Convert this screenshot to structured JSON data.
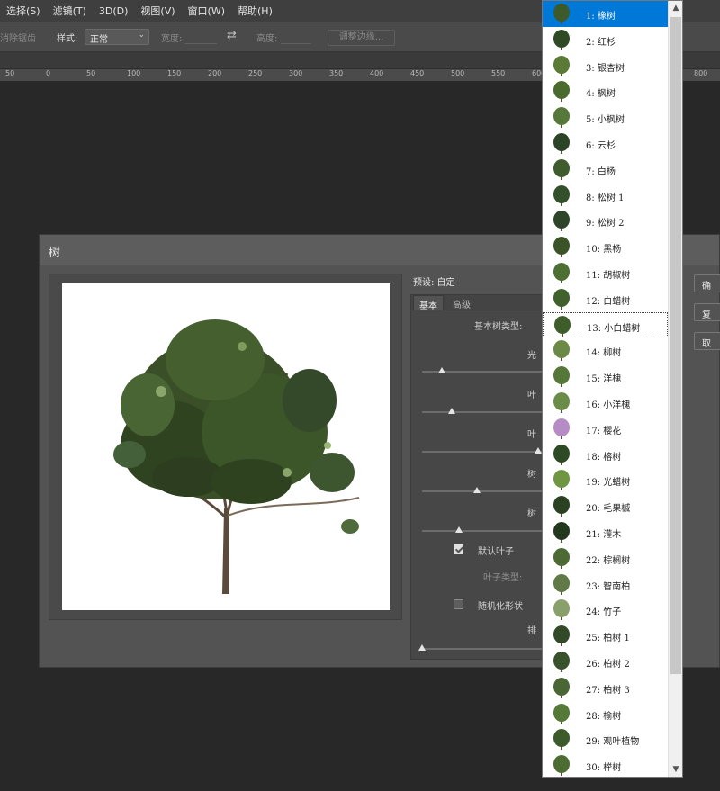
{
  "menu": [
    "选择(S)",
    "滤镜(T)",
    "3D(D)",
    "视图(V)",
    "窗口(W)",
    "帮助(H)"
  ],
  "options": {
    "antialias": "消除锯齿",
    "style_label": "样式:",
    "style_value": "正常",
    "width_label": "宽度:",
    "height_label": "高度:",
    "refine_button": "调整边缘..."
  },
  "ruler_ticks": [
    "50",
    "0",
    "50",
    "100",
    "150",
    "200",
    "250",
    "300",
    "350",
    "400",
    "450",
    "500",
    "550",
    "600",
    "650",
    "700",
    "750",
    "800"
  ],
  "dialog": {
    "title": "树",
    "preset_label": "预设: 自定",
    "tabs": [
      "基本",
      "高级"
    ],
    "base_type_label": "基本树类型:",
    "labels": [
      "光",
      "叶",
      "叶",
      "树",
      "树"
    ],
    "slider_levels": [
      0.16,
      0.24,
      0.95,
      0.45,
      0.3,
      0.0
    ],
    "default_leaves": "默认叶子",
    "default_leaves_checked": true,
    "leaf_type_label": "叶子类型:",
    "randomize": "随机化形状",
    "randomize_checked": false,
    "arrange_label": "排",
    "buttons": [
      "确",
      "复",
      "取"
    ]
  },
  "tree_types": [
    {
      "label": "1: 橡树",
      "color": "#3d5a2a"
    },
    {
      "label": "2: 红杉",
      "color": "#2f4a25"
    },
    {
      "label": "3: 银杏树",
      "color": "#5a7a35"
    },
    {
      "label": "4: 枫树",
      "color": "#4a6a2e"
    },
    {
      "label": "5: 小枫树",
      "color": "#56783a"
    },
    {
      "label": "6: 云杉",
      "color": "#2c4426"
    },
    {
      "label": "7: 白杨",
      "color": "#3e5c2c"
    },
    {
      "label": "8: 松树 1",
      "color": "#34502a"
    },
    {
      "label": "9: 松树 2",
      "color": "#2e452a"
    },
    {
      "label": "10: 黑杨",
      "color": "#3a5428"
    },
    {
      "label": "11: 胡椒树",
      "color": "#4e6f34"
    },
    {
      "label": "12: 白蜡树",
      "color": "#40602c"
    },
    {
      "label": "13: 小白蜡树",
      "color": "#3f5d2b"
    },
    {
      "label": "14: 柳树",
      "color": "#6b8a45"
    },
    {
      "label": "15: 洋槐",
      "color": "#557838"
    },
    {
      "label": "16: 小洋槐",
      "color": "#6a8c48"
    },
    {
      "label": "17: 樱花",
      "color": "#b68cc4"
    },
    {
      "label": "18: 榕树",
      "color": "#2e4a24"
    },
    {
      "label": "19: 光蜡树",
      "color": "#6f9640"
    },
    {
      "label": "20: 毛果槭",
      "color": "#2a4222"
    },
    {
      "label": "21: 灌木",
      "color": "#24381e"
    },
    {
      "label": "22: 棕榈树",
      "color": "#4d6a35"
    },
    {
      "label": "23: 智南柏",
      "color": "#607a45"
    },
    {
      "label": "24: 竹子",
      "color": "#8aa06a"
    },
    {
      "label": "25: 柏树 1",
      "color": "#324a28"
    },
    {
      "label": "26: 柏树 2",
      "color": "#3a522c"
    },
    {
      "label": "27: 柏树 3",
      "color": "#4a6634"
    },
    {
      "label": "28: 榆树",
      "color": "#557a38"
    },
    {
      "label": "29: 观叶植物",
      "color": "#3c5a2a"
    },
    {
      "label": "30: 榉树",
      "color": "#4c6c32"
    }
  ],
  "selected_index": 0,
  "focused_index": 12
}
